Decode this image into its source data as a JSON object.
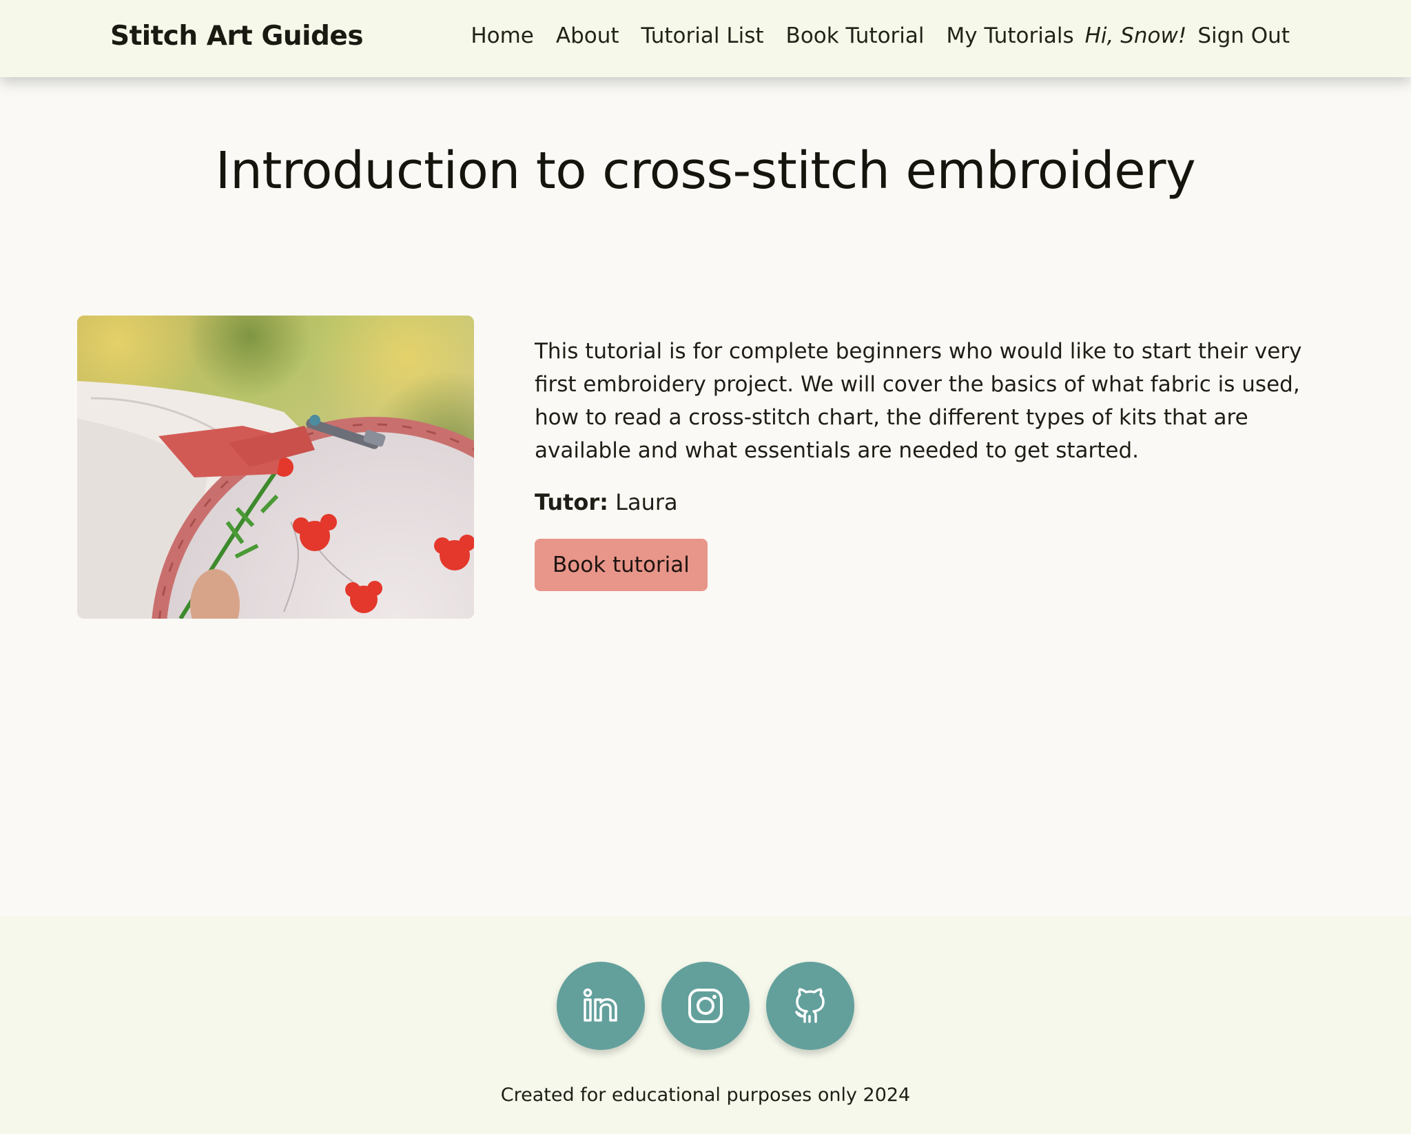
{
  "nav": {
    "brand": "Stitch Art Guides",
    "links": [
      "Home",
      "About",
      "Tutorial List",
      "Book Tutorial",
      "My Tutorials"
    ],
    "greeting": "Hi, Snow!",
    "signout": "Sign Out"
  },
  "tutorial": {
    "title": "Introduction to cross-stitch embroidery",
    "description": "This tutorial is for complete beginners who would like to start their very first embroidery project. We will cover the basics of what fabric is used, how to read a cross-stitch chart, the different types of kits that are available and what essentials are needed to get started.",
    "tutor_label": "Tutor:",
    "tutor_name": "Laura",
    "book_button": "Book tutorial"
  },
  "footer": {
    "socials": [
      "linkedin-icon",
      "instagram-icon",
      "github-icon"
    ],
    "note": "Created for educational purposes only 2024"
  },
  "colors": {
    "navbar_bg": "#f6f8ea",
    "page_bg": "#faf9f5",
    "button": "#e8958a",
    "social": "#63a09c"
  }
}
